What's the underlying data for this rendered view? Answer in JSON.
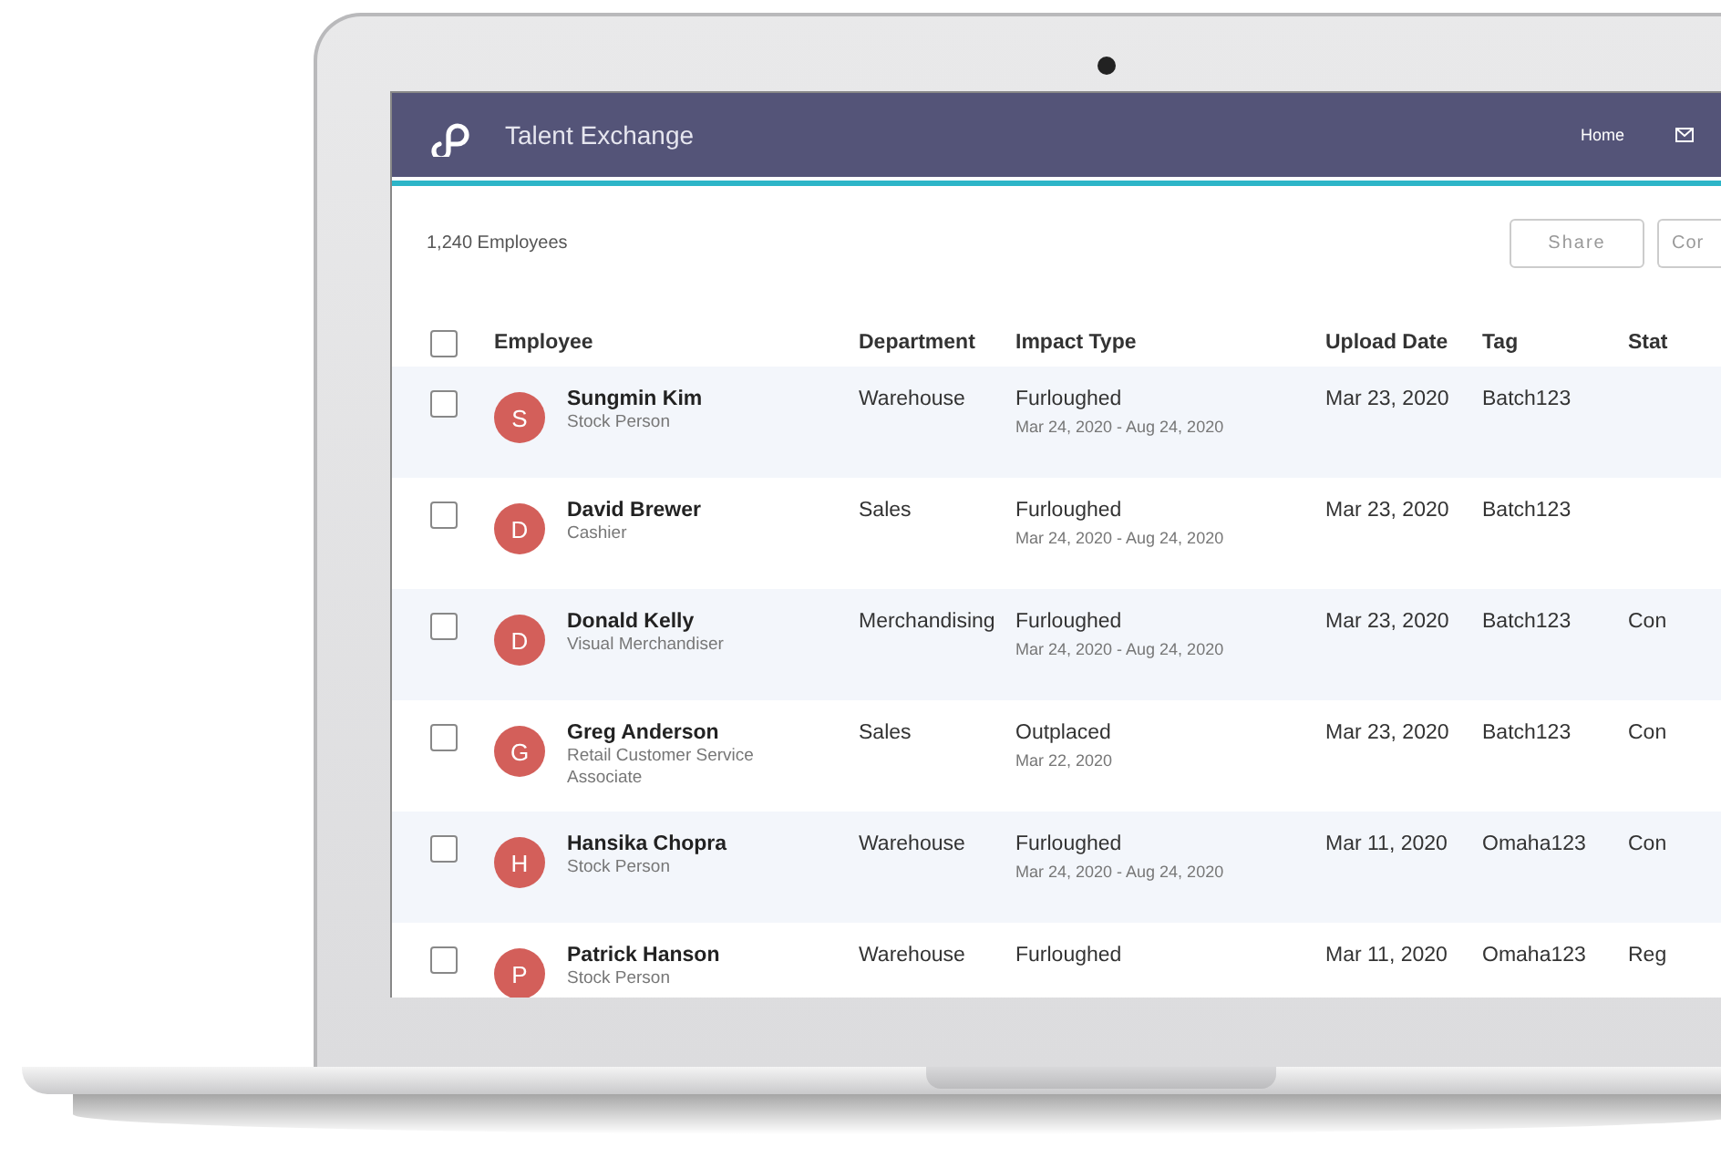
{
  "app_bar": {
    "title": "Talent Exchange",
    "nav": [
      {
        "label": "Home",
        "kind": "link"
      },
      {
        "kind": "mail"
      }
    ]
  },
  "toolbar": {
    "count": "1,240 Employees",
    "buttons": [
      "Share",
      "Cor"
    ]
  },
  "table": {
    "select_all": {
      "selected": false
    },
    "columns": [
      "Employee",
      "Department",
      "Impact Type",
      "Upload Date",
      "Tag",
      "Stat"
    ],
    "rows": [
      {
        "selected": false,
        "initial": "S",
        "name": "Sungmin Kim",
        "role": "Stock Person",
        "department": "Warehouse",
        "impact": "Furloughed",
        "impact_dates": "Mar 24, 2020 - Aug 24, 2020",
        "upload_date": "Mar 23, 2020",
        "tag": "Batch123"
      },
      {
        "selected": false,
        "initial": "D",
        "name": "David Brewer",
        "role": "Cashier",
        "department": "Sales",
        "impact": "Furloughed",
        "impact_dates": "Mar 24, 2020 - Aug 24, 2020",
        "upload_date": "Mar 23, 2020",
        "tag": "Batch123"
      },
      {
        "selected": false,
        "initial": "D",
        "name": "Donald Kelly",
        "role": "Visual Merchandiser",
        "department": "Merchandising",
        "impact": "Furloughed",
        "impact_dates": "Mar 24, 2020 - Aug 24, 2020",
        "upload_date": "Mar 23, 2020",
        "tag": "Batch123",
        "status": "Con"
      },
      {
        "selected": false,
        "initial": "G",
        "name": "Greg Anderson",
        "role": "Retail Customer Service Associate",
        "department": "Sales",
        "impact": "Outplaced",
        "impact_dates": "Mar 22, 2020",
        "upload_date": "Mar 23, 2020",
        "tag": "Batch123",
        "status": "Con"
      },
      {
        "selected": false,
        "initial": "H",
        "name": "Hansika Chopra",
        "role": "Stock Person",
        "department": "Warehouse",
        "impact": "Furloughed",
        "impact_dates": "Mar 24, 2020 - Aug 24, 2020",
        "upload_date": "Mar 11, 2020",
        "tag": "Omaha123",
        "status": "Con"
      },
      {
        "selected": false,
        "initial": "P",
        "name": "Patrick Hanson",
        "role": "Stock Person",
        "department": "Warehouse",
        "impact": "Furloughed",
        "upload_date": "Mar 11, 2020",
        "tag": "Omaha123",
        "status": "Reg"
      }
    ]
  }
}
